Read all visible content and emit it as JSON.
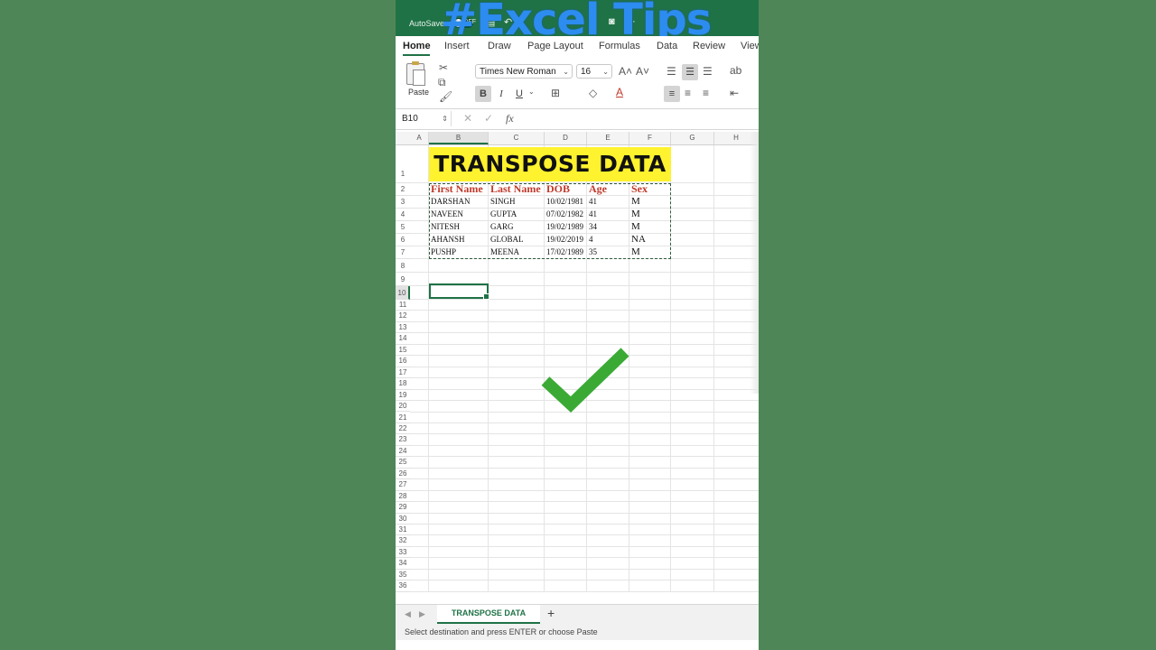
{
  "overlay_text": "#Excel Tips",
  "titlebar": {
    "autosave_label": "AutoSave",
    "toggle_state": "OFF"
  },
  "tabs": [
    "Home",
    "Insert",
    "Draw",
    "Page Layout",
    "Formulas",
    "Data",
    "Review",
    "View"
  ],
  "ribbon": {
    "paste_label": "Paste",
    "font_name": "Times New Roman",
    "font_size": "16",
    "bold": "B",
    "italic": "I",
    "underline": "U",
    "font_color_glyph": "A"
  },
  "formula_bar": {
    "name_box": "B10",
    "fx": "fx",
    "cancel_glyph": "✕",
    "enter_glyph": "✓"
  },
  "columns": [
    "A",
    "B",
    "C",
    "D",
    "E",
    "F",
    "G",
    "H"
  ],
  "rows": [
    "1",
    "2",
    "3",
    "4",
    "5",
    "6",
    "7",
    "8",
    "9",
    "10",
    "11",
    "12",
    "13",
    "14",
    "15",
    "16",
    "17",
    "18",
    "19",
    "20",
    "21",
    "22",
    "23",
    "24",
    "25",
    "26",
    "27",
    "28",
    "29",
    "30",
    "31",
    "32",
    "33",
    "34",
    "35",
    "36"
  ],
  "sheet": {
    "title": "TRANSPOSE DATA",
    "headers": [
      "First Name",
      "Last Name",
      "DOB",
      "Age",
      "Sex"
    ],
    "data": [
      [
        "DARSHAN",
        "SINGH",
        "10/02/1981",
        "41",
        "M"
      ],
      [
        "NAVEEN",
        "GUPTA",
        "07/02/1982",
        "41",
        "M"
      ],
      [
        "NITESH",
        "GARG",
        "19/02/1989",
        "34",
        "M"
      ],
      [
        "AHANSH",
        "GLOBAL",
        "19/02/2019",
        "4",
        "NA"
      ],
      [
        "PUSHP",
        "MEENA",
        "17/02/1989",
        "35",
        "M"
      ]
    ]
  },
  "sheet_tab": "TRANSPOSE DATA",
  "add_sheet": "+",
  "status": "Select destination and press ENTER or choose Paste",
  "colors": {
    "excel_green": "#1f7246",
    "title_fill": "#fff22e",
    "header_red": "#c0392b",
    "check_green": "#3aaa35",
    "background": "#4f8658",
    "overlay_blue": "#2d8cf0"
  },
  "icons": [
    "cut-icon",
    "copy-icon",
    "format-painter-icon",
    "increase-font-icon",
    "decrease-font-icon",
    "borders-icon",
    "fill-color-icon",
    "align-left-icon",
    "align-center-icon",
    "align-right-icon",
    "wrap-icon",
    "orientation-icon",
    "checkmark-icon"
  ]
}
